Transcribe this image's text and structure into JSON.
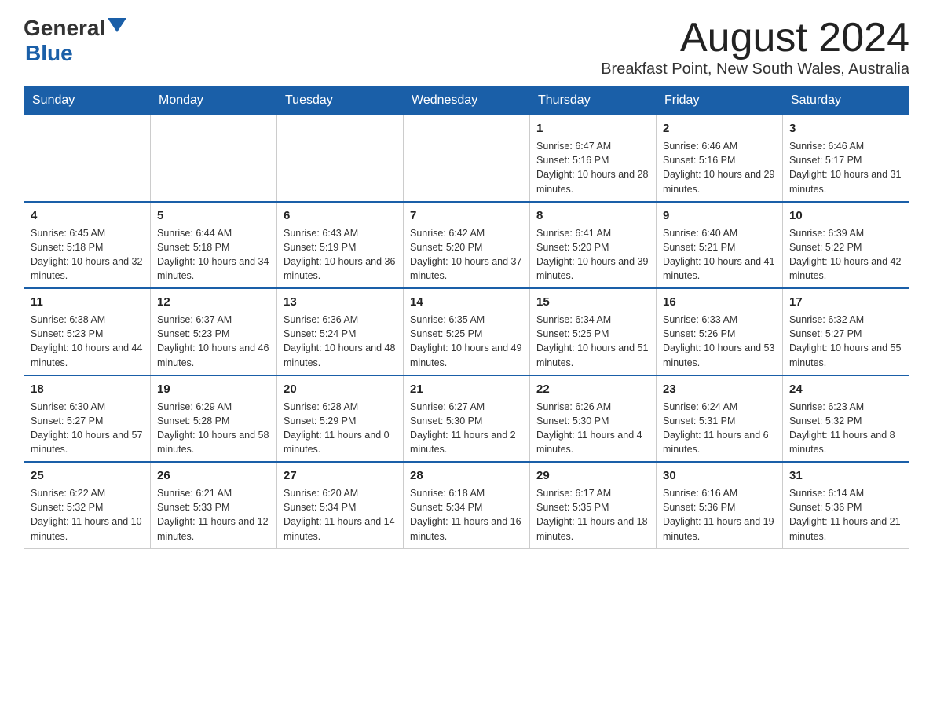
{
  "header": {
    "logo_general": "General",
    "logo_blue": "Blue",
    "month_title": "August 2024",
    "subtitle": "Breakfast Point, New South Wales, Australia"
  },
  "days_of_week": [
    "Sunday",
    "Monday",
    "Tuesday",
    "Wednesday",
    "Thursday",
    "Friday",
    "Saturday"
  ],
  "weeks": [
    {
      "days": [
        {
          "num": "",
          "info": ""
        },
        {
          "num": "",
          "info": ""
        },
        {
          "num": "",
          "info": ""
        },
        {
          "num": "",
          "info": ""
        },
        {
          "num": "1",
          "info": "Sunrise: 6:47 AM\nSunset: 5:16 PM\nDaylight: 10 hours and 28 minutes."
        },
        {
          "num": "2",
          "info": "Sunrise: 6:46 AM\nSunset: 5:16 PM\nDaylight: 10 hours and 29 minutes."
        },
        {
          "num": "3",
          "info": "Sunrise: 6:46 AM\nSunset: 5:17 PM\nDaylight: 10 hours and 31 minutes."
        }
      ]
    },
    {
      "days": [
        {
          "num": "4",
          "info": "Sunrise: 6:45 AM\nSunset: 5:18 PM\nDaylight: 10 hours and 32 minutes."
        },
        {
          "num": "5",
          "info": "Sunrise: 6:44 AM\nSunset: 5:18 PM\nDaylight: 10 hours and 34 minutes."
        },
        {
          "num": "6",
          "info": "Sunrise: 6:43 AM\nSunset: 5:19 PM\nDaylight: 10 hours and 36 minutes."
        },
        {
          "num": "7",
          "info": "Sunrise: 6:42 AM\nSunset: 5:20 PM\nDaylight: 10 hours and 37 minutes."
        },
        {
          "num": "8",
          "info": "Sunrise: 6:41 AM\nSunset: 5:20 PM\nDaylight: 10 hours and 39 minutes."
        },
        {
          "num": "9",
          "info": "Sunrise: 6:40 AM\nSunset: 5:21 PM\nDaylight: 10 hours and 41 minutes."
        },
        {
          "num": "10",
          "info": "Sunrise: 6:39 AM\nSunset: 5:22 PM\nDaylight: 10 hours and 42 minutes."
        }
      ]
    },
    {
      "days": [
        {
          "num": "11",
          "info": "Sunrise: 6:38 AM\nSunset: 5:23 PM\nDaylight: 10 hours and 44 minutes."
        },
        {
          "num": "12",
          "info": "Sunrise: 6:37 AM\nSunset: 5:23 PM\nDaylight: 10 hours and 46 minutes."
        },
        {
          "num": "13",
          "info": "Sunrise: 6:36 AM\nSunset: 5:24 PM\nDaylight: 10 hours and 48 minutes."
        },
        {
          "num": "14",
          "info": "Sunrise: 6:35 AM\nSunset: 5:25 PM\nDaylight: 10 hours and 49 minutes."
        },
        {
          "num": "15",
          "info": "Sunrise: 6:34 AM\nSunset: 5:25 PM\nDaylight: 10 hours and 51 minutes."
        },
        {
          "num": "16",
          "info": "Sunrise: 6:33 AM\nSunset: 5:26 PM\nDaylight: 10 hours and 53 minutes."
        },
        {
          "num": "17",
          "info": "Sunrise: 6:32 AM\nSunset: 5:27 PM\nDaylight: 10 hours and 55 minutes."
        }
      ]
    },
    {
      "days": [
        {
          "num": "18",
          "info": "Sunrise: 6:30 AM\nSunset: 5:27 PM\nDaylight: 10 hours and 57 minutes."
        },
        {
          "num": "19",
          "info": "Sunrise: 6:29 AM\nSunset: 5:28 PM\nDaylight: 10 hours and 58 minutes."
        },
        {
          "num": "20",
          "info": "Sunrise: 6:28 AM\nSunset: 5:29 PM\nDaylight: 11 hours and 0 minutes."
        },
        {
          "num": "21",
          "info": "Sunrise: 6:27 AM\nSunset: 5:30 PM\nDaylight: 11 hours and 2 minutes."
        },
        {
          "num": "22",
          "info": "Sunrise: 6:26 AM\nSunset: 5:30 PM\nDaylight: 11 hours and 4 minutes."
        },
        {
          "num": "23",
          "info": "Sunrise: 6:24 AM\nSunset: 5:31 PM\nDaylight: 11 hours and 6 minutes."
        },
        {
          "num": "24",
          "info": "Sunrise: 6:23 AM\nSunset: 5:32 PM\nDaylight: 11 hours and 8 minutes."
        }
      ]
    },
    {
      "days": [
        {
          "num": "25",
          "info": "Sunrise: 6:22 AM\nSunset: 5:32 PM\nDaylight: 11 hours and 10 minutes."
        },
        {
          "num": "26",
          "info": "Sunrise: 6:21 AM\nSunset: 5:33 PM\nDaylight: 11 hours and 12 minutes."
        },
        {
          "num": "27",
          "info": "Sunrise: 6:20 AM\nSunset: 5:34 PM\nDaylight: 11 hours and 14 minutes."
        },
        {
          "num": "28",
          "info": "Sunrise: 6:18 AM\nSunset: 5:34 PM\nDaylight: 11 hours and 16 minutes."
        },
        {
          "num": "29",
          "info": "Sunrise: 6:17 AM\nSunset: 5:35 PM\nDaylight: 11 hours and 18 minutes."
        },
        {
          "num": "30",
          "info": "Sunrise: 6:16 AM\nSunset: 5:36 PM\nDaylight: 11 hours and 19 minutes."
        },
        {
          "num": "31",
          "info": "Sunrise: 6:14 AM\nSunset: 5:36 PM\nDaylight: 11 hours and 21 minutes."
        }
      ]
    }
  ]
}
